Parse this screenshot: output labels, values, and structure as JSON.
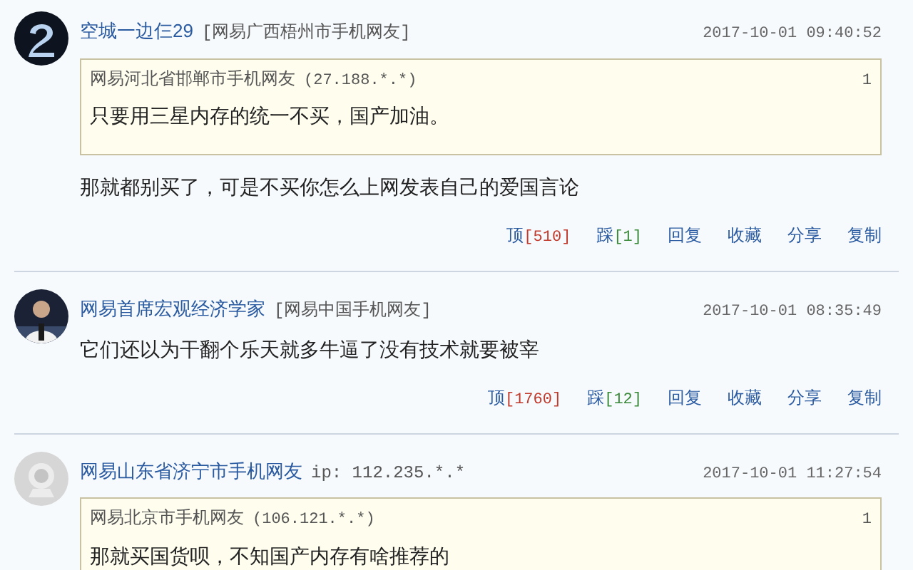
{
  "comments": [
    {
      "avatar": {
        "kind": "logo"
      },
      "name": "空城一边仨29",
      "source": "[网易广西梧州市手机网友]",
      "time": "2017-10-01 09:40:52",
      "quote": {
        "author": "网易河北省邯郸市手机网友",
        "ip": "(27.188.*.*)",
        "floor": "1",
        "text": "只要用三星内存的统一不买，国产加油。"
      },
      "text": "那就都别买了，可是不买你怎么上网发表自己的爱国言论",
      "actions": [
        {
          "kind": "up",
          "label": "顶",
          "count": "[510]"
        },
        {
          "kind": "down",
          "label": "踩",
          "count": "[1]"
        },
        {
          "kind": "plain",
          "label": "回复"
        },
        {
          "kind": "plain",
          "label": "收藏"
        },
        {
          "kind": "plain",
          "label": "分享"
        },
        {
          "kind": "plain",
          "label": "复制"
        }
      ]
    },
    {
      "avatar": {
        "kind": "person"
      },
      "name": "网易首席宏观经济学家",
      "source": "[网易中国手机网友]",
      "time": "2017-10-01 08:35:49",
      "text": "它们还以为干翻个乐天就多牛逼了没有技术就要被宰",
      "actions": [
        {
          "kind": "up",
          "label": "顶",
          "count": "[1760]"
        },
        {
          "kind": "down",
          "label": "踩",
          "count": "[12]"
        },
        {
          "kind": "plain",
          "label": "回复"
        },
        {
          "kind": "plain",
          "label": "收藏"
        },
        {
          "kind": "plain",
          "label": "分享"
        },
        {
          "kind": "plain",
          "label": "复制"
        }
      ]
    },
    {
      "avatar": {
        "kind": "default"
      },
      "name": "网易山东省济宁市手机网友",
      "source": "ip: 112.235.*.*",
      "time": "2017-10-01 11:27:54",
      "quote": {
        "author": "网易北京市手机网友",
        "ip": "(106.121.*.*)",
        "floor": "1",
        "text": "那就买国货呗，不知国产内存有啥推荐的"
      }
    }
  ]
}
